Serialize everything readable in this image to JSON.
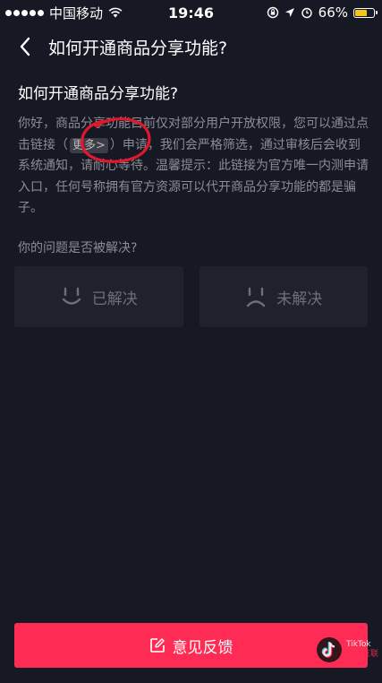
{
  "status_bar": {
    "carrier": "中国移动",
    "time": "19:46",
    "battery": "66%",
    "battery_level": 0.66
  },
  "nav": {
    "title": "如何开通商品分享功能?"
  },
  "article": {
    "title": "如何开通商品分享功能?",
    "body_part1": "你好，商品分享功能目前仅对部分用户开放权限，您可以通过点击链接（",
    "more_link": "更多>",
    "body_part2": "）申请，我们会严格筛选，通过审核后会收到系统通知，请耐心等待。温馨提示：此链接为官方唯一内测申请入口，任何号称拥有官方资源可以代开商品分享功能的都是骗子。"
  },
  "feedback": {
    "question": "你的问题是否被解决?",
    "resolved_label": "已解决",
    "unresolved_label": "未解决"
  },
  "bottom_button": {
    "label": "意见反馈"
  },
  "watermark": {
    "line1": "TikTok",
    "line2": "国际互联"
  },
  "colors": {
    "background": "#161823",
    "accent": "#fe2c55",
    "annotation": "#e0182f"
  }
}
